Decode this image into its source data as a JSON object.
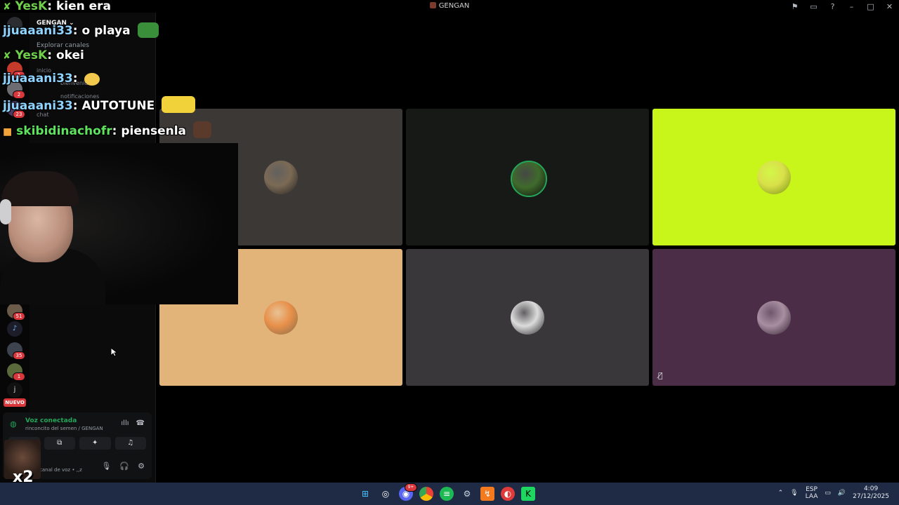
{
  "window": {
    "title": "GENGAN"
  },
  "sidebar": {
    "server_name": "GENGAN",
    "explore_label": "Explorar canales",
    "channels": [
      {
        "label": "inicio"
      },
      {
        "label": "bienvenidos"
      },
      {
        "label": "notificaciones"
      },
      {
        "label": "chat"
      }
    ],
    "server_badges": [
      "1",
      "2",
      "23",
      "51",
      "35",
      "1"
    ],
    "new_label": "NUEVO"
  },
  "voice": {
    "status": "Voz conectada",
    "channel_path": "rinconcito del semen / GENGAN",
    "user_status": "canal de voz • ,,z"
  },
  "stream_chat": [
    {
      "user": "YesK",
      "color": "#6fcf4a",
      "message": "kien era"
    },
    {
      "user": "jjuaaani33",
      "color": "#8fd3ff",
      "message": "o playa"
    },
    {
      "user": "YesK",
      "color": "#6fcf4a",
      "message": "okei"
    },
    {
      "user": "jjuaaani33",
      "color": "#8fd3ff",
      "message": ""
    },
    {
      "user": "jjuaaani33",
      "color": "#8fd3ff",
      "message": "AUTOTUNE"
    },
    {
      "user": "skibidinachofr",
      "color": "#5ee35e",
      "message": "piensenla"
    }
  ],
  "overlay": {
    "multiplier": "x2"
  },
  "video_tiles": [
    {
      "bg": "#3b3836",
      "avatar_color": "#7b6a55",
      "avatar": "otter-avatar"
    },
    {
      "bg": "#171916",
      "avatar_color": "#3f6b2c",
      "avatar": "green-avatar"
    },
    {
      "bg": "#c8f51a",
      "avatar_color": "#d9e04a",
      "avatar": "frog-avatar"
    },
    {
      "bg": "#e2b47a",
      "avatar_color": "#e8904a",
      "avatar": "sunset-avatar"
    },
    {
      "bg": "#3a373b",
      "avatar_color": "#dcdcdc",
      "avatar": "glasses-avatar"
    },
    {
      "bg": "#4b2d47",
      "avatar_color": "#a88fa2",
      "avatar": "person-avatar"
    }
  ],
  "taskbar": {
    "language": "ESP",
    "layout": "LAA",
    "time": "4:09",
    "date": "27/12/2025",
    "discord_badge": "9+"
  },
  "colors": {
    "accent_green": "#23a55a",
    "badge_red": "#da373c",
    "taskbar_bg": "#1f2a44"
  }
}
